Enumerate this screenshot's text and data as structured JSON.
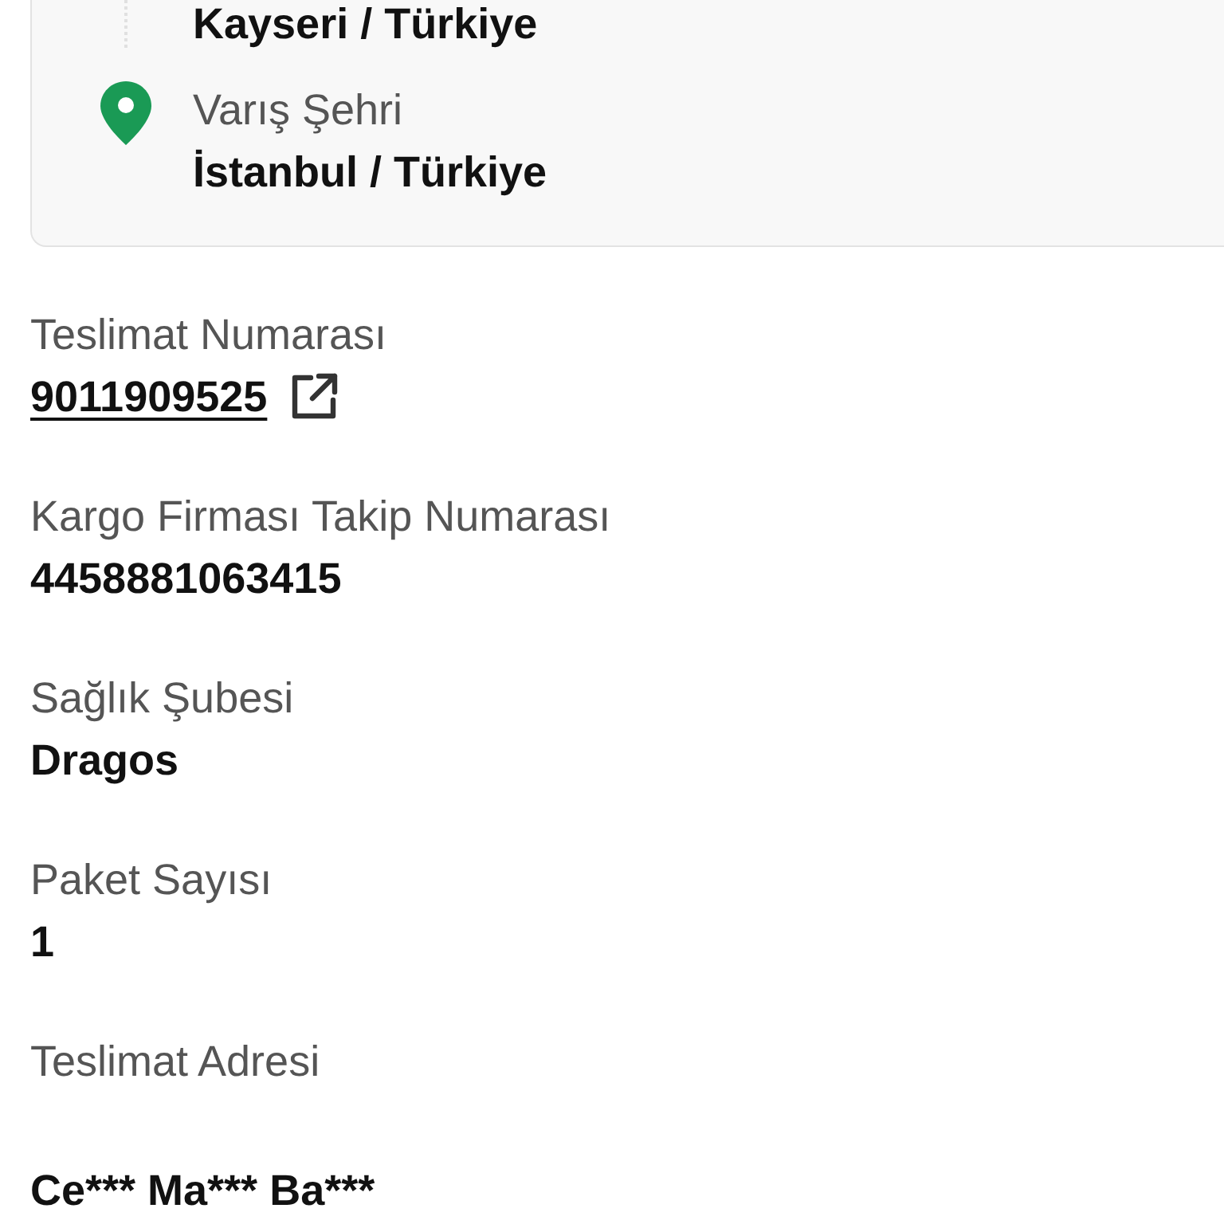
{
  "route": {
    "stops": [
      {
        "kind": "origin",
        "value": "Kayseri / Türkiye"
      },
      {
        "kind": "destination",
        "label": "Varış Şehri",
        "value": "İstanbul / Türkiye"
      }
    ]
  },
  "details": [
    {
      "kind": "link",
      "label": "Teslimat Numarası",
      "value": "9011909525"
    },
    {
      "kind": "text",
      "label": "Kargo Firması Takip Numarası",
      "value": "4458881063415"
    },
    {
      "kind": "text",
      "label": "Sağlık Şubesi",
      "value": "Dragos"
    },
    {
      "kind": "text",
      "label": "Paket Sayısı",
      "value": "1"
    },
    {
      "kind": "address",
      "label": "Teslimat Adresi",
      "value": "Ce*** Ma*** Ba***"
    }
  ]
}
